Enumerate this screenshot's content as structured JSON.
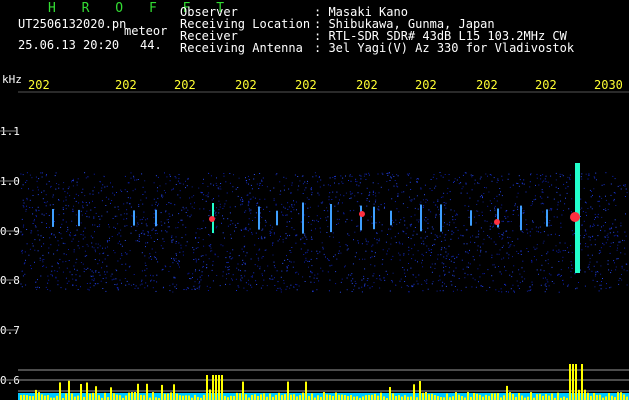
{
  "header": {
    "brand": "H R O F F T",
    "filename": "UT2506132020.pn",
    "file_suffix": "meteor",
    "datetime": "25.06.13 20:20",
    "count": "44."
  },
  "info": [
    {
      "key": "Observer",
      "value": ": Masaki Kano"
    },
    {
      "key": "Receiving Location",
      "value": ": Shibukawa, Gunma, Japan"
    },
    {
      "key": "Receiver",
      "value": ": RTL-SDR SDR# 43dB L15 103.2MHz CW"
    },
    {
      "key": "Receiving Antenna",
      "value": ": 3el Yagi(V) Az 330 for Vladivostok"
    }
  ],
  "chart_data": {
    "type": "heatmap",
    "ylabel": "kHz",
    "y_ticks": [
      "1.1",
      "1.0",
      "0.9",
      "0.8",
      "0.7",
      "0.6"
    ],
    "x_ticks": [
      "202",
      "202",
      "202",
      "202",
      "202",
      "202",
      "202",
      "202",
      "202",
      "2030"
    ],
    "ylim": [
      0.6,
      1.1
    ],
    "time_range_minutes": [
      20,
      30
    ]
  },
  "colors": {
    "text": "#ffffff",
    "brand": "#33dd33",
    "time_labels": "#ffff33",
    "signal_bars": "#ffff00",
    "noise_floor": "#00c8ff"
  }
}
